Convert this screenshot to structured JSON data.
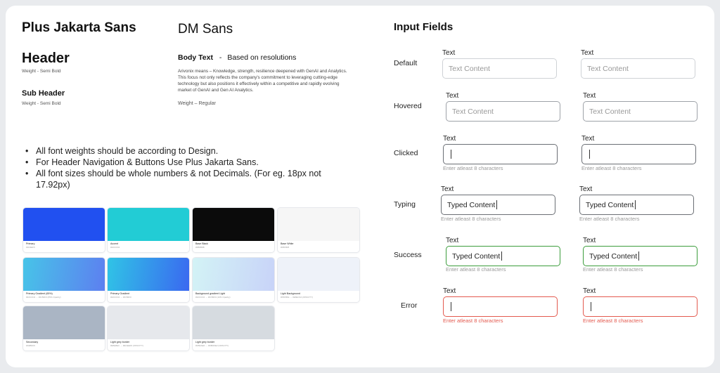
{
  "fonts": {
    "primary": "Plus Jakarta Sans",
    "secondary": "DM Sans",
    "header": "Header",
    "header_weight": "Weight - Semi Bold",
    "sub_header": "Sub Header",
    "sub_header_weight": "Weight - Semi Bold",
    "body_text_label": "Body Text",
    "body_text_dash": "-",
    "body_text_note": "Based on resolutions",
    "body_paragraph": "Arivonix means – Knowledge, strength, resilience deepened with GenAI and Analytics. This focus not only reflects the company's commitment to leveraging cutting-edge technology but also positions it effectively within a competitive and rapidly evolving market of GenAI and Gen AI Analytics.",
    "body_weight": "Weight – Regular"
  },
  "guidelines": [
    "All font weights should be according to Design.",
    "For Header Navigation & Buttons Use Plus Jakarta Sans.",
    "All font sizes should be whole numbers & not Decimals. (For eg. 18px not 17.92px)"
  ],
  "palette": [
    {
      "name": "Primary",
      "hex": "#1D4EF5",
      "color": "#2150f0"
    },
    {
      "name": "Accent",
      "hex": "#22CCD4",
      "color": "#22ccd5"
    },
    {
      "name": "Base Black",
      "hex": "#0B0B0B",
      "color": "#0b0b0b"
    },
    {
      "name": "Base White",
      "hex": "#F8F8F8",
      "color": "#f6f6f6"
    },
    {
      "name": "Primary Gradient (65%)",
      "hex": "#22CCD4 → #2150F0 (65% Opacity)",
      "color": "linear-gradient(100deg,#47c4e8,#5d7ff0)"
    },
    {
      "name": "Primary Gradient",
      "hex": "#22CCD4 → #2150F0",
      "color": "linear-gradient(100deg,#30c4e6,#3a68f0)"
    },
    {
      "name": "Background gradient Light",
      "hex": "#22CCD4 → #2150F0 (10% Opacity)",
      "color": "linear-gradient(100deg,#d3f3f6,#c8d3f8)"
    },
    {
      "name": "Light Background",
      "hex": "#F5F8FE → #E6ECFA (OPACITY)",
      "color": "#eef2f9"
    },
    {
      "name": "Secondary",
      "hex": "#A9B6C6",
      "color": "#aab5c4"
    },
    {
      "name": "Light grey border",
      "hex": "#E5E8EC → #ECEEF0 (OPACITY)",
      "color": "#e6e8ec"
    },
    {
      "name": "Light grey border",
      "hex": "#D5DAE0 → #D8DDE2 (OPACITY)",
      "color": "#d6dbe0"
    }
  ],
  "inputs": {
    "title": "Input Fields",
    "label": "Text",
    "placeholder": "Text Content",
    "typed": "Typed Content",
    "helper": "Enter atleast 8 characters",
    "states": [
      "Default",
      "Hovered",
      "Clicked",
      "Typing",
      "Success",
      "Error"
    ]
  },
  "colors": {
    "success": "#3c9d3c",
    "error": "#e35a4f",
    "border": "#cfd2d6"
  }
}
